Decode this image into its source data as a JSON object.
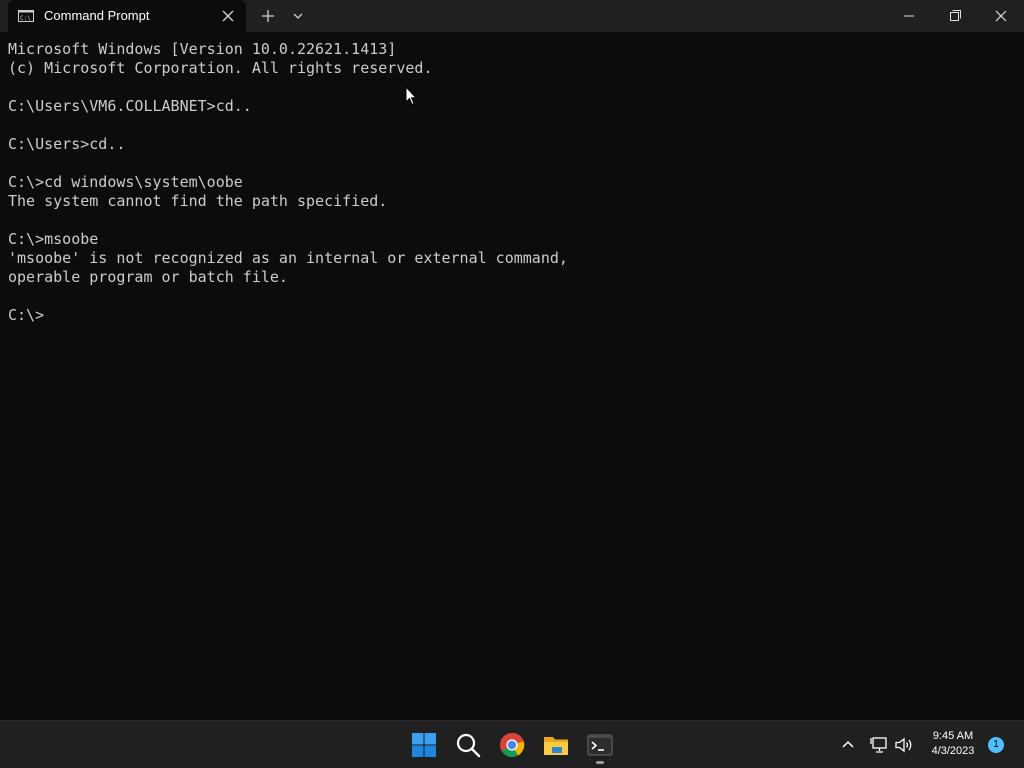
{
  "window": {
    "tab_title": "Command Prompt",
    "tab_icon": "cmd-icon",
    "controls": [
      "minimize-icon",
      "restore-icon",
      "close-icon"
    ]
  },
  "console": {
    "lines": [
      "Microsoft Windows [Version 10.0.22621.1413]",
      "(c) Microsoft Corporation. All rights reserved.",
      "",
      "C:\\Users\\VM6.COLLABNET>cd..",
      "",
      "C:\\Users>cd..",
      "",
      "C:\\>cd windows\\system\\oobe",
      "The system cannot find the path specified.",
      "",
      "C:\\>msoobe",
      "'msoobe' is not recognized as an internal or external command,",
      "operable program or batch file.",
      "",
      "C:\\>"
    ]
  },
  "taskbar": {
    "apps": [
      "windows-start-icon",
      "search-icon",
      "chrome-icon",
      "file-explorer-icon",
      "terminal-icon"
    ],
    "tray": {
      "icons": [
        "chevron-up-icon",
        "network-icon",
        "volume-icon"
      ],
      "time": "9:45 AM",
      "date": "4/3/2023",
      "notification_count": "1"
    }
  },
  "colors": {
    "console_bg": "#0c0c0c",
    "console_text": "#cccccc",
    "titlebar_bg": "#202020",
    "taskbar_bg": "#202020",
    "accent": "#4cc2ff"
  }
}
